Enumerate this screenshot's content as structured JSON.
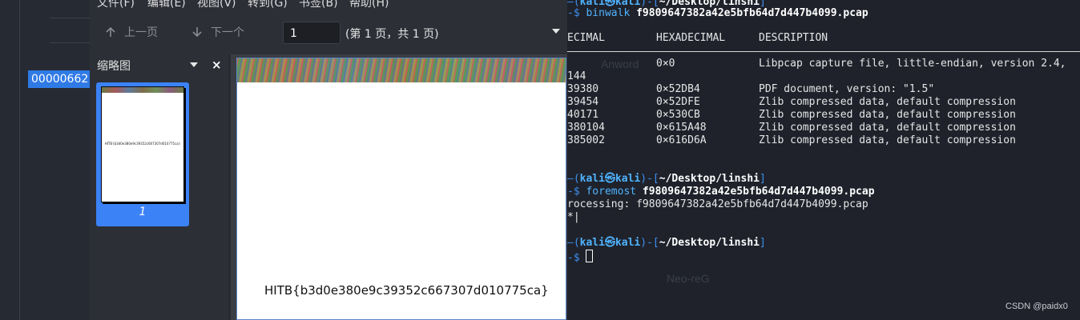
{
  "left_app": {
    "selected_hex": "00000662"
  },
  "viewer": {
    "menu": [
      "文件(F)",
      "编辑(E)",
      "视图(V)",
      "转到(G)",
      "书签(B)",
      "帮助(H)"
    ],
    "toolbar": {
      "prev_label": "上一页",
      "next_label": "下一个",
      "page_value": "1",
      "page_count": "(第 1 页，共 1 页)"
    },
    "sidebar": {
      "title": "缩略图",
      "close": "×",
      "thumbnail_label": "1",
      "thumbnail_text": "HITB{b3d0e380e9c39352c667307d010775ca}"
    },
    "document": {
      "flag_text": "HITB{b3d0e380e9c39352c667307d010775ca}"
    }
  },
  "terminal": {
    "prompt1": {
      "top": "—(",
      "user": "kali㉿kali",
      "mid": ")-[",
      "path": "~/Desktop/linshi",
      "end": "]"
    },
    "cmd1": {
      "prefix": "-$ ",
      "cmd": "binwalk",
      "arg": " f9809647382a42e5bfb64d7d447b4099.pcap"
    },
    "headers": {
      "decimal": "ECIMAL",
      "hex": "HEXADECIMAL",
      "desc": "DESCRIPTION"
    },
    "rows": [
      {
        "dec": "",
        "hex": "0×0",
        "desc": "Libpcap capture file, little-endian, version 2.4,"
      },
      {
        "dec": "144",
        "hex": "",
        "desc": ""
      },
      {
        "dec": "39380",
        "hex": "0×52DB4",
        "desc": "PDF document, version: \"1.5\""
      },
      {
        "dec": "39454",
        "hex": "0×52DFE",
        "desc": "Zlib compressed data, default compression"
      },
      {
        "dec": "40171",
        "hex": "0×530CB",
        "desc": "Zlib compressed data, default compression"
      },
      {
        "dec": "380104",
        "hex": "0×615A48",
        "desc": "Zlib compressed data, default compression"
      },
      {
        "dec": "385002",
        "hex": "0×616D6A",
        "desc": "Zlib compressed data, default compression"
      }
    ],
    "prompt2": {
      "top": "—(",
      "user": "kali㉿kali",
      "mid": ")-[",
      "path": "~/Desktop/linshi",
      "end": "]"
    },
    "cmd2": {
      "prefix": "-$ ",
      "cmd": "foremost",
      "arg": " f9809647382a42e5bfb64d7d447b4099.pcap"
    },
    "processing": "rocessing: f9809647382a42e5bfb64d7d447b4099.pcap",
    "progress": "*|",
    "prompt3": {
      "top": "—(",
      "user": "kali㉿kali",
      "mid": ")-[",
      "path": "~/Desktop/linshi",
      "end": "]"
    },
    "cmd3": {
      "prefix": "-$ "
    },
    "ghost_text_1": "Anword",
    "ghost_text_2": "Neo-reG"
  },
  "watermark": "CSDN @paidx0"
}
